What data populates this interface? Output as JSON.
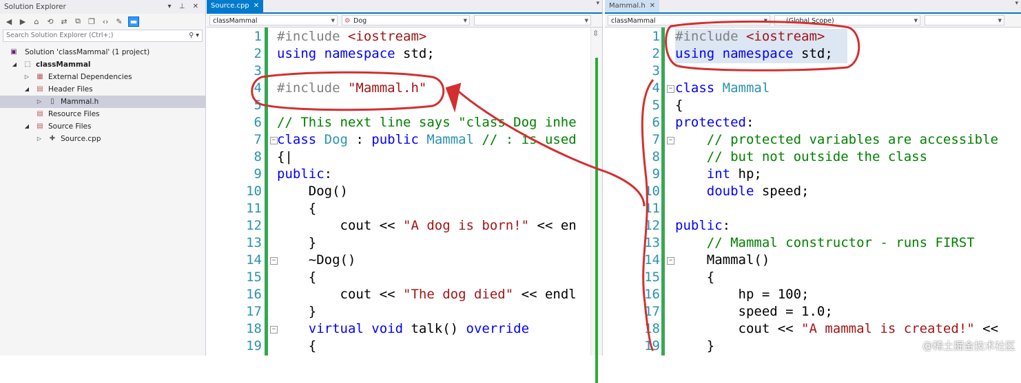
{
  "solution_explorer": {
    "title": "Solution Explorer",
    "title_controls": "▾ ⊥ ✕",
    "search_placeholder": "Search Solution Explorer (Ctrl+;)",
    "tree": [
      {
        "label": "Solution 'classMammal' (1 project)",
        "icon": "solution-icon",
        "expander": ""
      },
      {
        "label": "classMammal",
        "icon": "project-icon",
        "expander": "◢",
        "bold": true
      },
      {
        "label": "External Dependencies",
        "icon": "references-icon",
        "expander": "▷"
      },
      {
        "label": "Header Files",
        "icon": "filter-icon",
        "expander": "◢"
      },
      {
        "label": "Mammal.h",
        "icon": "header-file-icon",
        "expander": "▷",
        "selected": true
      },
      {
        "label": "Resource Files",
        "icon": "filter-icon",
        "expander": ""
      },
      {
        "label": "Source Files",
        "icon": "filter-icon",
        "expander": "◢"
      },
      {
        "label": "Source.cpp",
        "icon": "cpp-file-icon",
        "expander": "▷"
      }
    ]
  },
  "editor_left": {
    "tab_label": "Source.cpp",
    "tab_close": "✕",
    "nav_project": "classMammal",
    "nav_scope": "Dog",
    "nav_member": "",
    "line_numbers": [
      "1",
      "2",
      "3",
      "4",
      "5",
      "6",
      "7",
      "8",
      "9",
      "10",
      "11",
      "12",
      "13",
      "14",
      "15",
      "16",
      "17",
      "18",
      "19"
    ],
    "lines": [
      [
        [
          "pp",
          "#include "
        ],
        [
          "str",
          "<iostream>"
        ]
      ],
      [
        [
          "kw",
          "using namespace "
        ],
        [
          "",
          "std;"
        ]
      ],
      [],
      [
        [
          "pp",
          "#include "
        ],
        [
          "str",
          "\"Mammal.h\""
        ]
      ],
      [],
      [
        [
          "cm",
          "// This next line says \"class Dog inhe"
        ]
      ],
      [
        [
          "kw",
          "class "
        ],
        [
          "ty",
          "Dog"
        ],
        [
          "",
          " : "
        ],
        [
          "kw",
          "public "
        ],
        [
          "ty",
          "Mammal"
        ],
        [
          "cm",
          " // : is used"
        ]
      ],
      [
        [
          "",
          "{|"
        ]
      ],
      [
        [
          "kw",
          "public"
        ],
        [
          "",
          ":"
        ]
      ],
      [
        [
          "",
          "    Dog()"
        ]
      ],
      [
        [
          "",
          "    {"
        ]
      ],
      [
        [
          "",
          "        cout << "
        ],
        [
          "str",
          "\"A dog is born!\""
        ],
        [
          "",
          " << en"
        ]
      ],
      [
        [
          "",
          "    }"
        ]
      ],
      [
        [
          "",
          "    ~Dog()"
        ]
      ],
      [
        [
          "",
          "    {"
        ]
      ],
      [
        [
          "",
          "        cout << "
        ],
        [
          "str",
          "\"The dog died\""
        ],
        [
          "",
          " << endl"
        ]
      ],
      [
        [
          "",
          "    }"
        ]
      ],
      [
        [
          "kw",
          "    virtual void "
        ],
        [
          "",
          "talk() "
        ],
        [
          "kw",
          "override"
        ]
      ],
      [
        [
          "",
          "    {"
        ]
      ]
    ]
  },
  "editor_right": {
    "tab_label": "Mammal.h",
    "tab_close": "✕",
    "nav_project": "classMammal",
    "nav_scope": "(Global Scope)",
    "nav_member": "",
    "line_numbers": [
      "1",
      "2",
      "3",
      "4",
      "5",
      "6",
      "7",
      "8",
      "9",
      "10",
      "11",
      "12",
      "13",
      "14",
      "15",
      "16",
      "17",
      "18",
      "19"
    ],
    "lines": [
      [
        [
          "pp",
          "#include "
        ],
        [
          "str",
          "<iostream>"
        ]
      ],
      [
        [
          "kw",
          "using namespace "
        ],
        [
          "",
          "std;"
        ]
      ],
      [],
      [
        [
          "kw",
          "class "
        ],
        [
          "ty",
          "Mammal"
        ]
      ],
      [
        [
          "",
          "{"
        ]
      ],
      [
        [
          "kw",
          "protected"
        ],
        [
          "",
          ":"
        ]
      ],
      [
        [
          "cm",
          "    // protected variables are accessible"
        ]
      ],
      [
        [
          "cm",
          "    // but not outside the class"
        ]
      ],
      [
        [
          "kw",
          "    int "
        ],
        [
          "",
          "hp;"
        ]
      ],
      [
        [
          "kw",
          "    double "
        ],
        [
          "",
          "speed;"
        ]
      ],
      [],
      [
        [
          "kw",
          "public"
        ],
        [
          "",
          ":"
        ]
      ],
      [
        [
          "cm",
          "    // Mammal constructor - runs FIRST"
        ]
      ],
      [
        [
          "",
          "    Mammal()"
        ]
      ],
      [
        [
          "",
          "    {"
        ]
      ],
      [
        [
          "",
          "        hp = 100;"
        ]
      ],
      [
        [
          "",
          "        speed = 1.0;"
        ]
      ],
      [
        [
          "",
          "        cout << "
        ],
        [
          "str",
          "\"A mammal is created!\""
        ],
        [
          "",
          " <<"
        ]
      ],
      [
        [
          "",
          "    }"
        ]
      ]
    ]
  },
  "watermark": "@稀土掘金技术社区",
  "colors": {
    "annotation": "#d32f2f",
    "accent": "#007acc",
    "change_bar": "#2eaa37"
  }
}
